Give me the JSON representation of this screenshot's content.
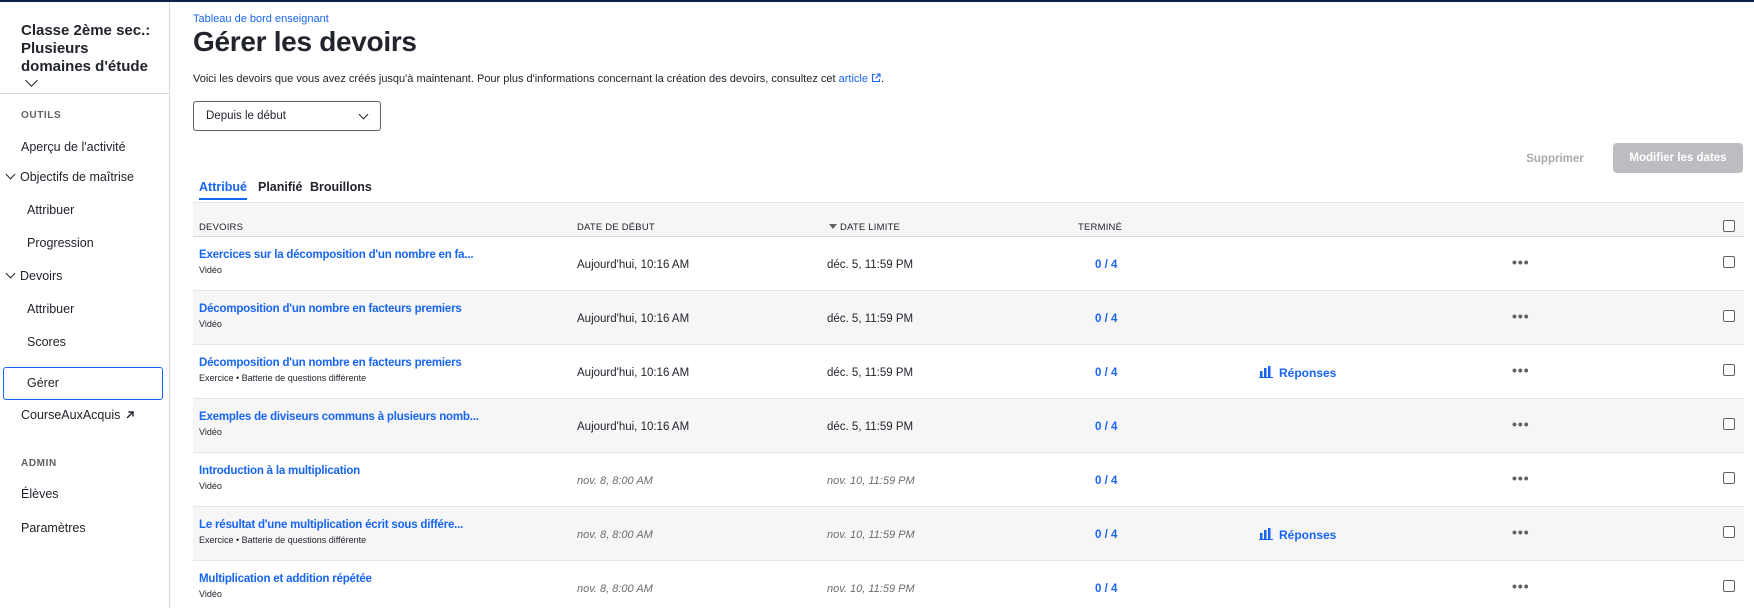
{
  "sidebar": {
    "class_title": "Classe 2ème sec.: Plusieurs domaines d'étude",
    "sections": {
      "tools": "OUTILS",
      "admin": "ADMIN"
    },
    "items": {
      "activity": "Aperçu de l'activité",
      "mastery_group": "Objectifs de maîtrise",
      "mastery_assign": "Attribuer",
      "mastery_progress": "Progression",
      "assignments_group": "Devoirs",
      "assignments_assign": "Attribuer",
      "assignments_scores": "Scores",
      "assignments_manage": "Gérer",
      "course_challenge": "CourseAuxAcquis",
      "students": "Élèves",
      "settings": "Paramètres"
    },
    "active_item": "Gérer"
  },
  "header": {
    "breadcrumb": "Tableau de bord enseignant",
    "title": "Gérer les devoirs",
    "intro_text": "Voici les devoirs que vous avez créés jusqu'à maintenant. Pour plus d'informations concernant la création des devoirs, consultez cet ",
    "intro_link": "article",
    "intro_end": "."
  },
  "filter": {
    "selected": "Depuis le début"
  },
  "actions": {
    "delete": "Supprimer",
    "edit_dates": "Modifier les dates"
  },
  "tabs": [
    {
      "label": "Attribué",
      "active": true
    },
    {
      "label": "Planifié",
      "active": false
    },
    {
      "label": "Brouillons",
      "active": false
    }
  ],
  "table": {
    "headers": {
      "assignments": "DEVOIRS",
      "start_date": "DATE DE DÉBUT",
      "due_date": "DATE LIMITE",
      "completed": "TERMINÉ"
    },
    "sort_column": "DATE LIMITE",
    "rows": [
      {
        "title": "Exercices sur la décomposition d'un nombre en fa...",
        "type": "Vidéo",
        "start": "Aujourd'hui, 10:16 AM",
        "due": "déc. 5, 11:59 PM",
        "done": "0 / 4",
        "responses": ""
      },
      {
        "title": "Décomposition d'un nombre en facteurs premiers",
        "type": "Vidéo",
        "start": "Aujourd'hui, 10:16 AM",
        "due": "déc. 5, 11:59 PM",
        "done": "0 / 4",
        "responses": ""
      },
      {
        "title": "Décomposition d'un nombre en facteurs premiers",
        "type": "Exercice • Batterie de questions différente",
        "start": "Aujourd'hui, 10:16 AM",
        "due": "déc. 5, 11:59 PM",
        "done": "0 / 4",
        "responses": "Réponses"
      },
      {
        "title": "Exemples de diviseurs communs à plusieurs nomb...",
        "type": "Vidéo",
        "start": "Aujourd'hui, 10:16 AM",
        "due": "déc. 5, 11:59 PM",
        "done": "0 / 4",
        "responses": ""
      },
      {
        "title": "Introduction à la multiplication",
        "type": "Vidéo",
        "start": "nov. 8, 8:00 AM",
        "due": "nov. 10, 11:59 PM",
        "done": "0 / 4",
        "responses": ""
      },
      {
        "title": "Le résultat d'une multiplication écrit sous différe...",
        "type": "Exercice • Batterie de questions différente",
        "start": "nov. 8, 8:00 AM",
        "due": "nov. 10, 11:59 PM",
        "done": "0 / 4",
        "responses": "Réponses"
      },
      {
        "title": "Multiplication et addition répétée",
        "type": "Vidéo",
        "start": "nov. 8, 8:00 AM",
        "due": "nov. 10, 11:59 PM",
        "done": "0 / 4",
        "responses": ""
      }
    ],
    "more_label": "•••"
  },
  "colors": {
    "accent": "#1865f2",
    "text": "#21242c",
    "muted": "#5f6167",
    "row_alt": "#f6f6f7",
    "disabled_button": "#bbbdc0"
  }
}
